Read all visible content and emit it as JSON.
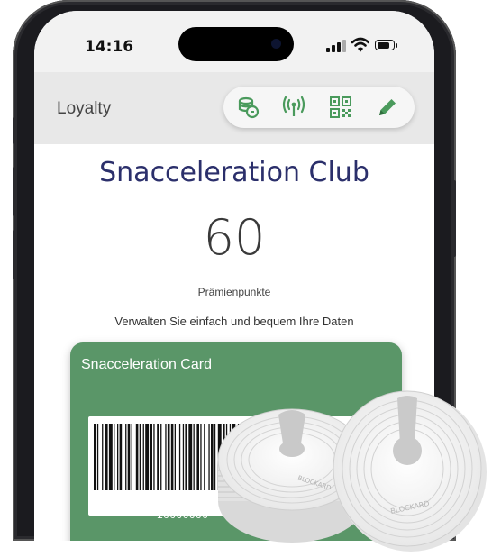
{
  "status_bar": {
    "time": "14:16"
  },
  "app_bar": {
    "title": "Loyalty",
    "actions": [
      {
        "icon": "coins-icon"
      },
      {
        "icon": "nfc-antenna-icon"
      },
      {
        "icon": "qr-code-icon"
      },
      {
        "icon": "pencil-icon"
      }
    ]
  },
  "club": {
    "title": "Snacceleration Club",
    "points": "60",
    "points_label": "Prämienpunkte",
    "subtitle": "Verwalten Sie einfach und bequem Ihre Daten"
  },
  "card": {
    "title": "Snacceleration Card",
    "barcode_number": "10000000",
    "color": "#5a9668"
  },
  "overlay": {
    "nfc_tag_label": "BLOCKARD"
  },
  "colors": {
    "accent_green": "#4a9a5c",
    "title_navy": "#2b2f6b"
  }
}
